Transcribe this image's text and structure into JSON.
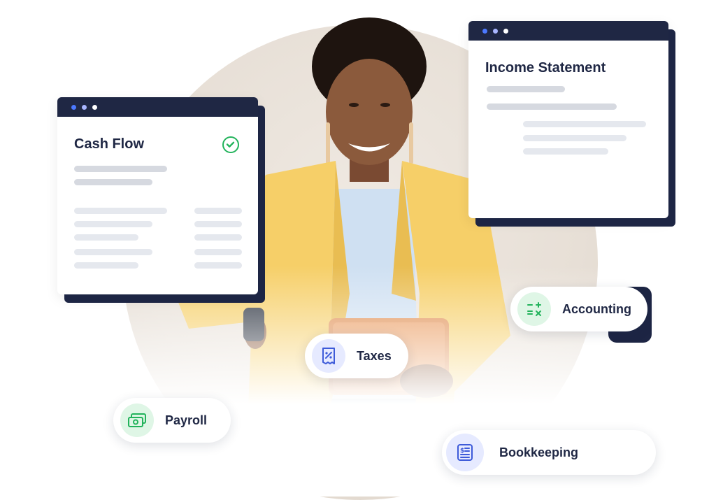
{
  "cards": {
    "cash_flow": {
      "title": "Cash Flow",
      "status_icon": "check-circle-icon",
      "status_color": "#22b35b"
    },
    "income_statement": {
      "title": "Income Statement"
    }
  },
  "pills": {
    "accounting": {
      "label": "Accounting",
      "icon": "calculator-icon"
    },
    "taxes": {
      "label": "Taxes",
      "icon": "tax-receipt-icon"
    },
    "payroll": {
      "label": "Payroll",
      "icon": "money-icon"
    },
    "bookkeeping": {
      "label": "Bookkeeping",
      "icon": "ledger-icon"
    }
  },
  "colors": {
    "navy": "#1f2744",
    "accent_blue": "#4c79ff",
    "accent_green": "#22b35b",
    "jacket": "#f6cf68"
  }
}
